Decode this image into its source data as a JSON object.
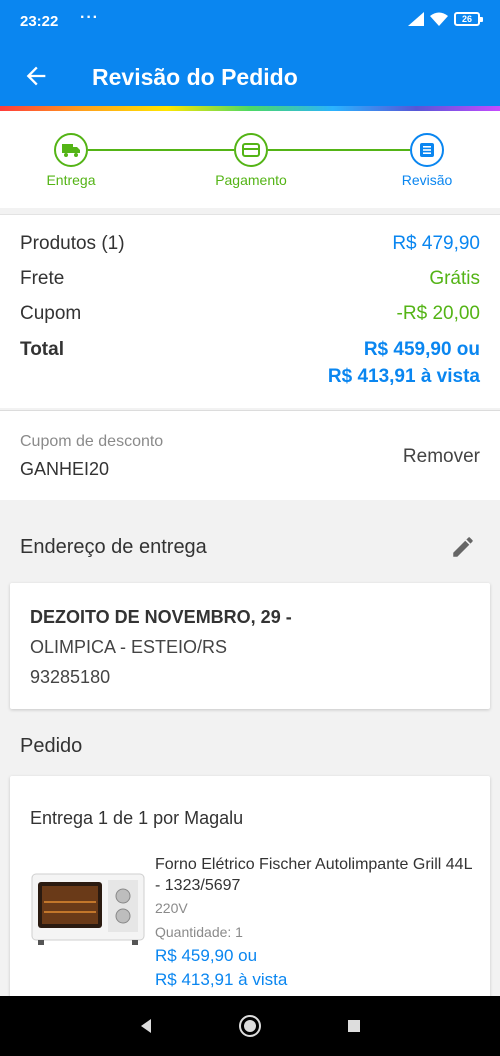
{
  "status_bar": {
    "time": "23:22",
    "dots": "···",
    "battery": "26"
  },
  "header": {
    "title": "Revisão do Pedido"
  },
  "steps": [
    {
      "label": "Entrega",
      "icon": "truck-icon"
    },
    {
      "label": "Pagamento",
      "icon": "card-icon"
    },
    {
      "label": "Revisão",
      "icon": "checklist-icon"
    }
  ],
  "summary": {
    "products_label": "Produtos (1)",
    "products_value": "R$ 479,90",
    "shipping_label": "Frete",
    "shipping_value": "Grátis",
    "coupon_label": "Cupom",
    "coupon_value": "-R$ 20,00",
    "total_label": "Total",
    "total_value": "R$ 459,90 ou",
    "total_cash": "R$ 413,91 à vista"
  },
  "coupon": {
    "label": "Cupom de desconto",
    "code": "GANHEI20",
    "remove_label": "Remover"
  },
  "address": {
    "section_title": "Endereço de entrega",
    "line1": "DEZOITO DE NOVEMBRO, 29 -",
    "line2": "OLIMPICA - ESTEIO/RS",
    "line3": "93285180"
  },
  "order": {
    "section_title": "Pedido",
    "delivery": "Entrega 1 de 1 por Magalu",
    "product": {
      "name": "Forno Elétrico Fischer Autolimpante Grill 44L - 1323/5697",
      "voltage": "220V",
      "quantity": "Quantidade:  1",
      "price": "R$ 459,90 ou",
      "price_cash": "R$ 413,91 à vista"
    }
  },
  "colors": {
    "primary": "#0a86f0",
    "success": "#54b416"
  }
}
